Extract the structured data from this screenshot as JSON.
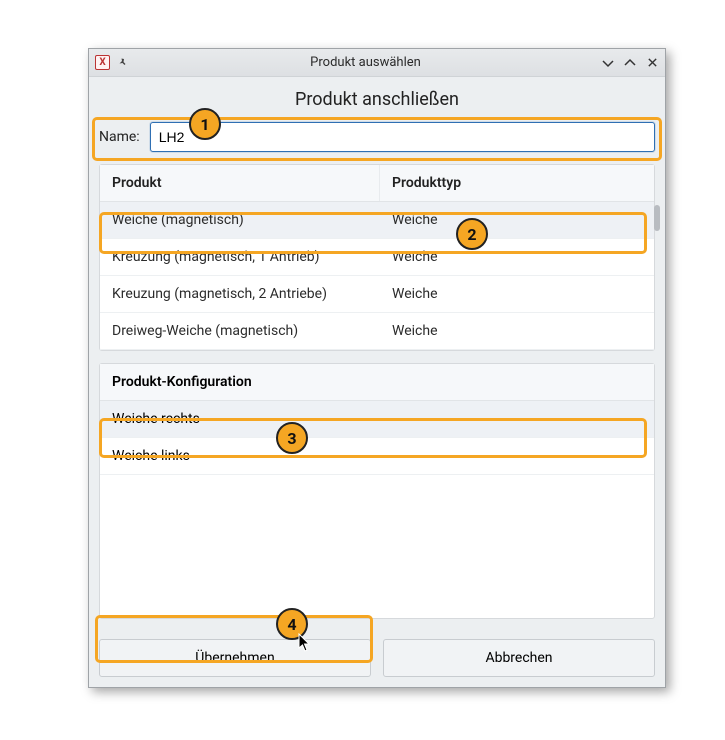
{
  "window": {
    "title": "Produkt auswählen"
  },
  "heading": "Produkt anschließen",
  "name": {
    "label": "Name:",
    "value": "LH2"
  },
  "table": {
    "headers": {
      "product": "Produkt",
      "type": "Produkttyp"
    },
    "rows": [
      {
        "product": "Weiche (magnetisch)",
        "type": "Weiche",
        "selected": true
      },
      {
        "product": "Kreuzung (magnetisch, 1 Antrieb)",
        "type": "Weiche",
        "selected": false
      },
      {
        "product": "Kreuzung (magnetisch, 2 Antriebe)",
        "type": "Weiche",
        "selected": false
      },
      {
        "product": "Dreiweg-Weiche (magnetisch)",
        "type": "Weiche",
        "selected": false
      }
    ]
  },
  "config": {
    "header": "Produkt-Konfiguration",
    "rows": [
      {
        "label": "Weiche rechts",
        "selected": true
      },
      {
        "label": "Weiche links",
        "selected": false
      }
    ]
  },
  "buttons": {
    "apply": "Übernehmen",
    "cancel": "Abbrechen"
  },
  "callouts": {
    "c1": "1",
    "c2": "2",
    "c3": "3",
    "c4": "4"
  }
}
